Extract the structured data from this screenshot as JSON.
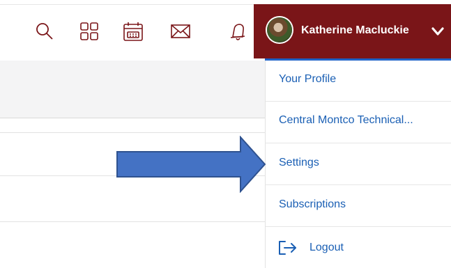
{
  "header": {
    "icons": [
      "search-icon",
      "apps-grid-icon",
      "calendar-icon",
      "mail-icon",
      "bell-icon"
    ],
    "user": {
      "name": "Katherine Macluckie",
      "accent_color": "#7a1518"
    }
  },
  "menu": {
    "items": [
      {
        "label": "Your Profile"
      },
      {
        "label": "Central Montco Technical..."
      },
      {
        "label": "Settings"
      },
      {
        "label": "Subscriptions"
      }
    ],
    "logout_label": "Logout",
    "link_color": "#1a5fb4"
  },
  "annotation": {
    "arrow_color": "#4472c4",
    "arrow_target": "Settings"
  }
}
